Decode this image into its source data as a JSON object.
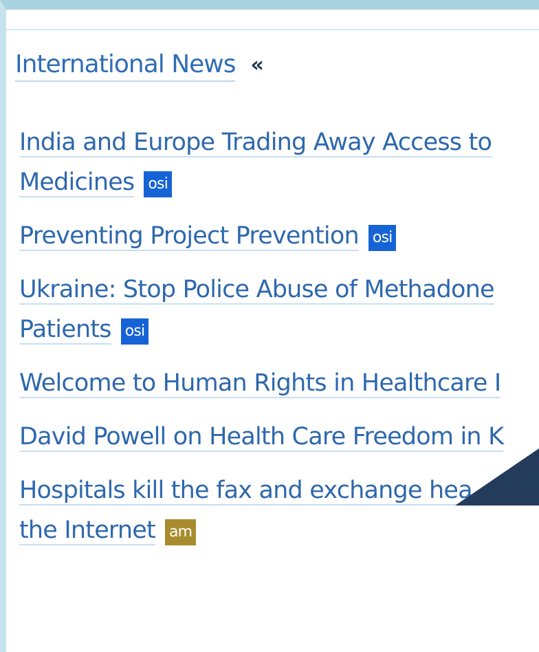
{
  "colors": {
    "frame_top": "#a9d3e0",
    "frame_left": "#c5e3ec",
    "link": "#2e68ad",
    "tag_osi": "#1663d6",
    "tag_am": "#a88c2e",
    "pointer": "#243c5c"
  },
  "section": {
    "title": "International News",
    "toggle": "«"
  },
  "news": [
    {
      "title_line1": "India and Europe Trading Away Access to",
      "title_line2": "Medicines",
      "tag": "osi"
    },
    {
      "title": "Preventing Project Prevention",
      "tag": "osi"
    },
    {
      "title_line1": "Ukraine: Stop Police Abuse of Methadone",
      "title_line2": "Patients",
      "tag": "osi"
    },
    {
      "title": "Welcome to Human Rights in Healthcare I"
    },
    {
      "title": "David Powell on Health Care Freedom in K"
    },
    {
      "title_line1": "Hospitals kill the fax and exchange hea",
      "title_line2": "the Internet",
      "tag": "am"
    }
  ],
  "icons": {
    "pointer": "pointer-arrow-icon"
  }
}
